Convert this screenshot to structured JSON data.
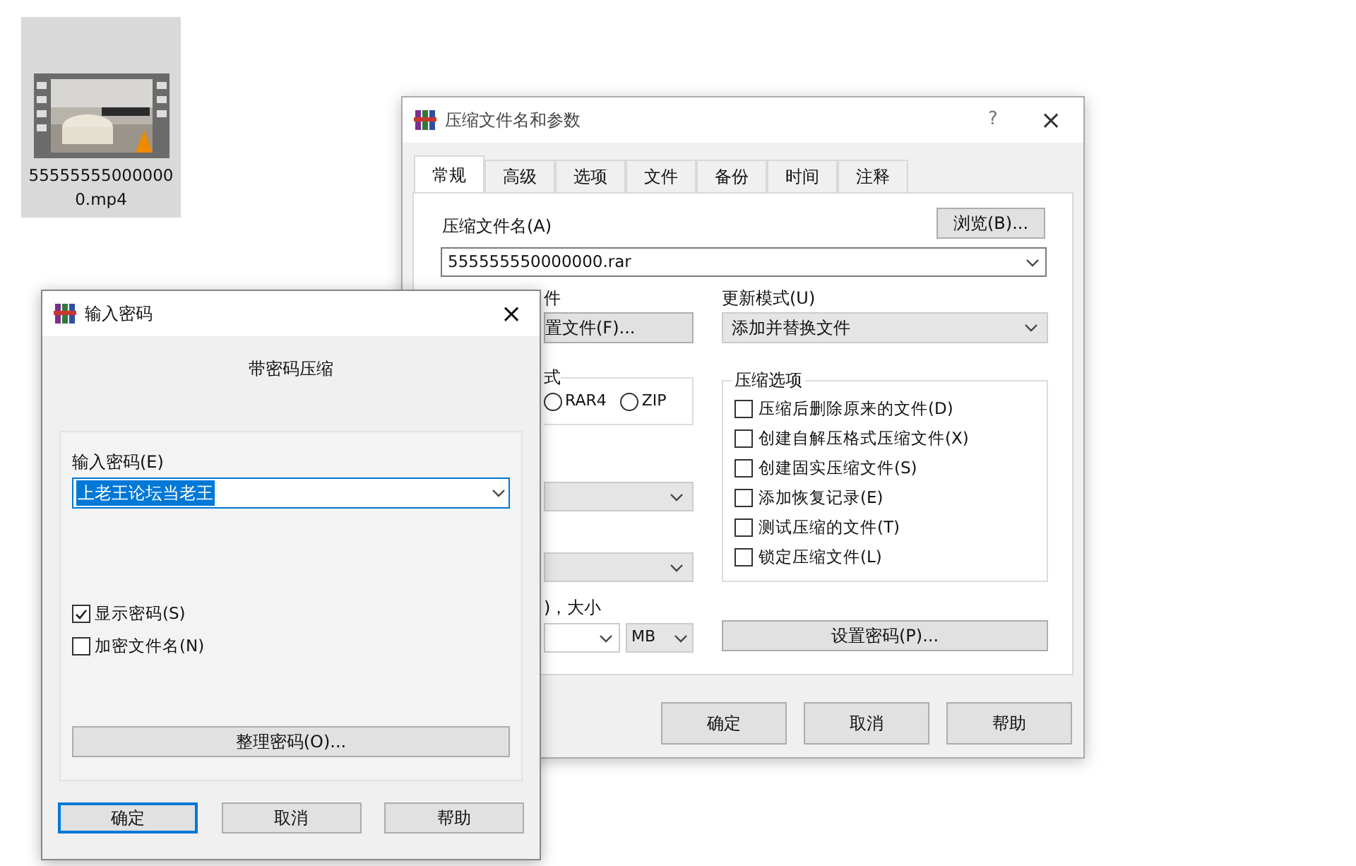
{
  "desktop_icon": {
    "label": "555555550000000.mp4",
    "selected": true
  },
  "archive_dialog": {
    "title": "压缩文件名和参数",
    "help_button": "?",
    "close_button": "×",
    "tabs": [
      {
        "label": "常规",
        "selected": true
      },
      {
        "label": "高级",
        "selected": false
      },
      {
        "label": "选项",
        "selected": false
      },
      {
        "label": "文件",
        "selected": false
      },
      {
        "label": "备份",
        "selected": false
      },
      {
        "label": "时间",
        "selected": false
      },
      {
        "label": "注释",
        "selected": false
      }
    ],
    "archive_name_label": "压缩文件名(A)",
    "browse_button": "浏览(B)...",
    "archive_name_value": "555555550000000.rar",
    "profile_label_fragment": "件",
    "profile_button_fragment": "置文件(F)...",
    "format_group_fragment": "式",
    "formats": [
      {
        "label": "RAR4",
        "selected": false
      },
      {
        "label": "ZIP",
        "selected": false
      }
    ],
    "split_label_fragment": ")，大小",
    "split_unit": "MB",
    "update_mode_label": "更新模式(U)",
    "update_mode_value": "添加并替换文件",
    "options_label": "压缩选项",
    "options": [
      {
        "label": "压缩后删除原来的文件(D)",
        "checked": false
      },
      {
        "label": "创建自解压格式压缩文件(X)",
        "checked": false
      },
      {
        "label": "创建固实压缩文件(S)",
        "checked": false
      },
      {
        "label": "添加恢复记录(E)",
        "checked": false
      },
      {
        "label": "测试压缩的文件(T)",
        "checked": false
      },
      {
        "label": "锁定压缩文件(L)",
        "checked": false
      }
    ],
    "set_password_button": "设置密码(P)...",
    "buttons": [
      "确定",
      "取消",
      "帮助"
    ]
  },
  "password_dialog": {
    "title": "输入密码",
    "close_button": "×",
    "heading": "带密码压缩",
    "password_label": "输入密码(E)",
    "password_value": "上老王论坛当老王",
    "checkboxes": [
      {
        "label": "显示密码(S)",
        "checked": true
      },
      {
        "label": "加密文件名(N)",
        "checked": false
      }
    ],
    "organize_button": "整理密码(O)...",
    "buttons": [
      {
        "label": "确定",
        "focused": true
      },
      {
        "label": "取消",
        "focused": false
      },
      {
        "label": "帮助",
        "focused": false
      }
    ]
  }
}
